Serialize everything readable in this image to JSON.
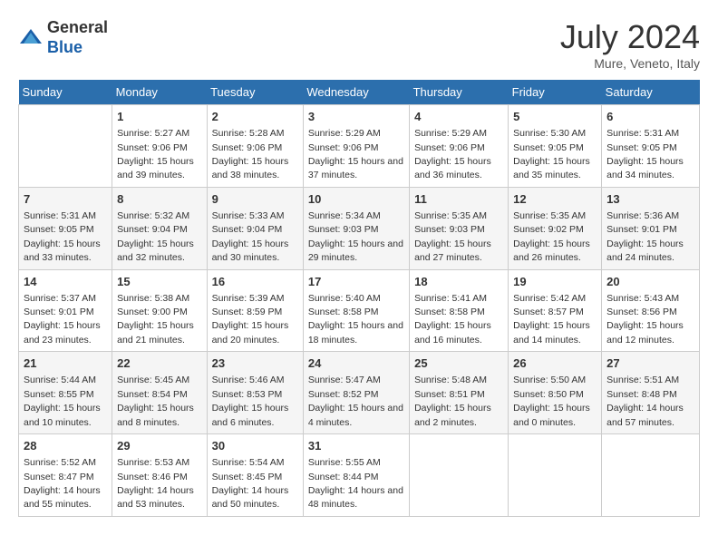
{
  "header": {
    "logo_general": "General",
    "logo_blue": "Blue",
    "month_title": "July 2024",
    "location": "Mure, Veneto, Italy"
  },
  "days_of_week": [
    "Sunday",
    "Monday",
    "Tuesday",
    "Wednesday",
    "Thursday",
    "Friday",
    "Saturday"
  ],
  "weeks": [
    [
      null,
      {
        "num": "1",
        "sunrise": "5:27 AM",
        "sunset": "9:06 PM",
        "daylight": "15 hours and 39 minutes."
      },
      {
        "num": "2",
        "sunrise": "5:28 AM",
        "sunset": "9:06 PM",
        "daylight": "15 hours and 38 minutes."
      },
      {
        "num": "3",
        "sunrise": "5:29 AM",
        "sunset": "9:06 PM",
        "daylight": "15 hours and 37 minutes."
      },
      {
        "num": "4",
        "sunrise": "5:29 AM",
        "sunset": "9:06 PM",
        "daylight": "15 hours and 36 minutes."
      },
      {
        "num": "5",
        "sunrise": "5:30 AM",
        "sunset": "9:05 PM",
        "daylight": "15 hours and 35 minutes."
      },
      {
        "num": "6",
        "sunrise": "5:31 AM",
        "sunset": "9:05 PM",
        "daylight": "15 hours and 34 minutes."
      }
    ],
    [
      {
        "num": "7",
        "sunrise": "5:31 AM",
        "sunset": "9:05 PM",
        "daylight": "15 hours and 33 minutes."
      },
      {
        "num": "8",
        "sunrise": "5:32 AM",
        "sunset": "9:04 PM",
        "daylight": "15 hours and 32 minutes."
      },
      {
        "num": "9",
        "sunrise": "5:33 AM",
        "sunset": "9:04 PM",
        "daylight": "15 hours and 30 minutes."
      },
      {
        "num": "10",
        "sunrise": "5:34 AM",
        "sunset": "9:03 PM",
        "daylight": "15 hours and 29 minutes."
      },
      {
        "num": "11",
        "sunrise": "5:35 AM",
        "sunset": "9:03 PM",
        "daylight": "15 hours and 27 minutes."
      },
      {
        "num": "12",
        "sunrise": "5:35 AM",
        "sunset": "9:02 PM",
        "daylight": "15 hours and 26 minutes."
      },
      {
        "num": "13",
        "sunrise": "5:36 AM",
        "sunset": "9:01 PM",
        "daylight": "15 hours and 24 minutes."
      }
    ],
    [
      {
        "num": "14",
        "sunrise": "5:37 AM",
        "sunset": "9:01 PM",
        "daylight": "15 hours and 23 minutes."
      },
      {
        "num": "15",
        "sunrise": "5:38 AM",
        "sunset": "9:00 PM",
        "daylight": "15 hours and 21 minutes."
      },
      {
        "num": "16",
        "sunrise": "5:39 AM",
        "sunset": "8:59 PM",
        "daylight": "15 hours and 20 minutes."
      },
      {
        "num": "17",
        "sunrise": "5:40 AM",
        "sunset": "8:58 PM",
        "daylight": "15 hours and 18 minutes."
      },
      {
        "num": "18",
        "sunrise": "5:41 AM",
        "sunset": "8:58 PM",
        "daylight": "15 hours and 16 minutes."
      },
      {
        "num": "19",
        "sunrise": "5:42 AM",
        "sunset": "8:57 PM",
        "daylight": "15 hours and 14 minutes."
      },
      {
        "num": "20",
        "sunrise": "5:43 AM",
        "sunset": "8:56 PM",
        "daylight": "15 hours and 12 minutes."
      }
    ],
    [
      {
        "num": "21",
        "sunrise": "5:44 AM",
        "sunset": "8:55 PM",
        "daylight": "15 hours and 10 minutes."
      },
      {
        "num": "22",
        "sunrise": "5:45 AM",
        "sunset": "8:54 PM",
        "daylight": "15 hours and 8 minutes."
      },
      {
        "num": "23",
        "sunrise": "5:46 AM",
        "sunset": "8:53 PM",
        "daylight": "15 hours and 6 minutes."
      },
      {
        "num": "24",
        "sunrise": "5:47 AM",
        "sunset": "8:52 PM",
        "daylight": "15 hours and 4 minutes."
      },
      {
        "num": "25",
        "sunrise": "5:48 AM",
        "sunset": "8:51 PM",
        "daylight": "15 hours and 2 minutes."
      },
      {
        "num": "26",
        "sunrise": "5:50 AM",
        "sunset": "8:50 PM",
        "daylight": "15 hours and 0 minutes."
      },
      {
        "num": "27",
        "sunrise": "5:51 AM",
        "sunset": "8:48 PM",
        "daylight": "14 hours and 57 minutes."
      }
    ],
    [
      {
        "num": "28",
        "sunrise": "5:52 AM",
        "sunset": "8:47 PM",
        "daylight": "14 hours and 55 minutes."
      },
      {
        "num": "29",
        "sunrise": "5:53 AM",
        "sunset": "8:46 PM",
        "daylight": "14 hours and 53 minutes."
      },
      {
        "num": "30",
        "sunrise": "5:54 AM",
        "sunset": "8:45 PM",
        "daylight": "14 hours and 50 minutes."
      },
      {
        "num": "31",
        "sunrise": "5:55 AM",
        "sunset": "8:44 PM",
        "daylight": "14 hours and 48 minutes."
      },
      null,
      null,
      null
    ]
  ]
}
